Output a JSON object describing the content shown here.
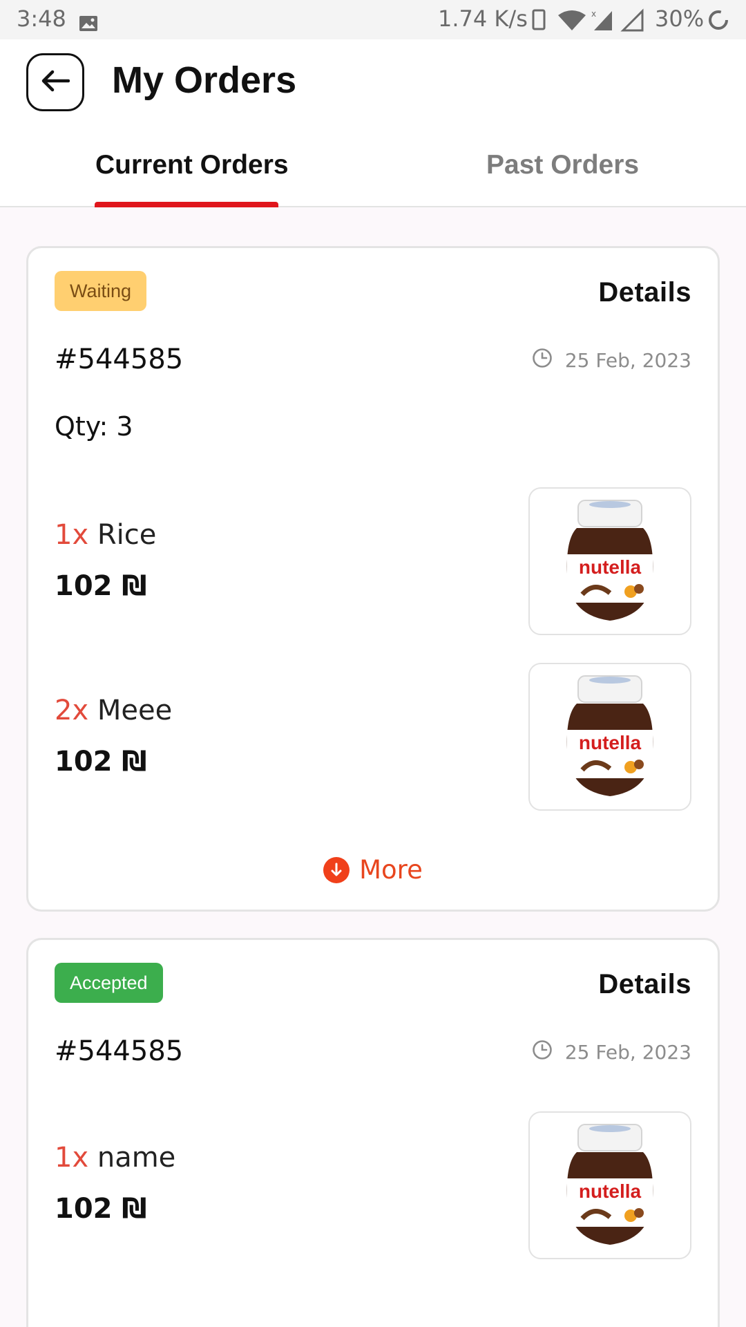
{
  "status_bar": {
    "time": "3:48",
    "net_speed": "1.74 K/s",
    "battery": "30%"
  },
  "header": {
    "title": "My Orders",
    "back_icon": "arrow-left-icon"
  },
  "tabs": [
    {
      "label": "Current Orders",
      "active": true
    },
    {
      "label": "Past Orders",
      "active": false
    }
  ],
  "colors": {
    "accent": "#e0161c",
    "waiting_badge": "#ffcf70",
    "accepted_badge": "#3cae4d",
    "quantity_multiplier": "#e24a3b",
    "more_link": "#e8461e"
  },
  "orders": [
    {
      "status": "Waiting",
      "details_label": "Details",
      "id": "#544585",
      "date": "25 Feb, 2023",
      "qty_label": "Qty: 3",
      "items": [
        {
          "multiplier": "1x",
          "name": "Rice",
          "price": "102 ₪",
          "image": "nutella-jar"
        },
        {
          "multiplier": "2x",
          "name": "Meee",
          "price": "102 ₪",
          "image": "nutella-jar"
        }
      ],
      "more_label": "More"
    },
    {
      "status": "Accepted",
      "details_label": "Details",
      "id": "#544585",
      "date": "25 Feb, 2023",
      "items": [
        {
          "multiplier": "1x",
          "name": "name",
          "price": "102 ₪",
          "image": "nutella-jar"
        }
      ]
    }
  ]
}
